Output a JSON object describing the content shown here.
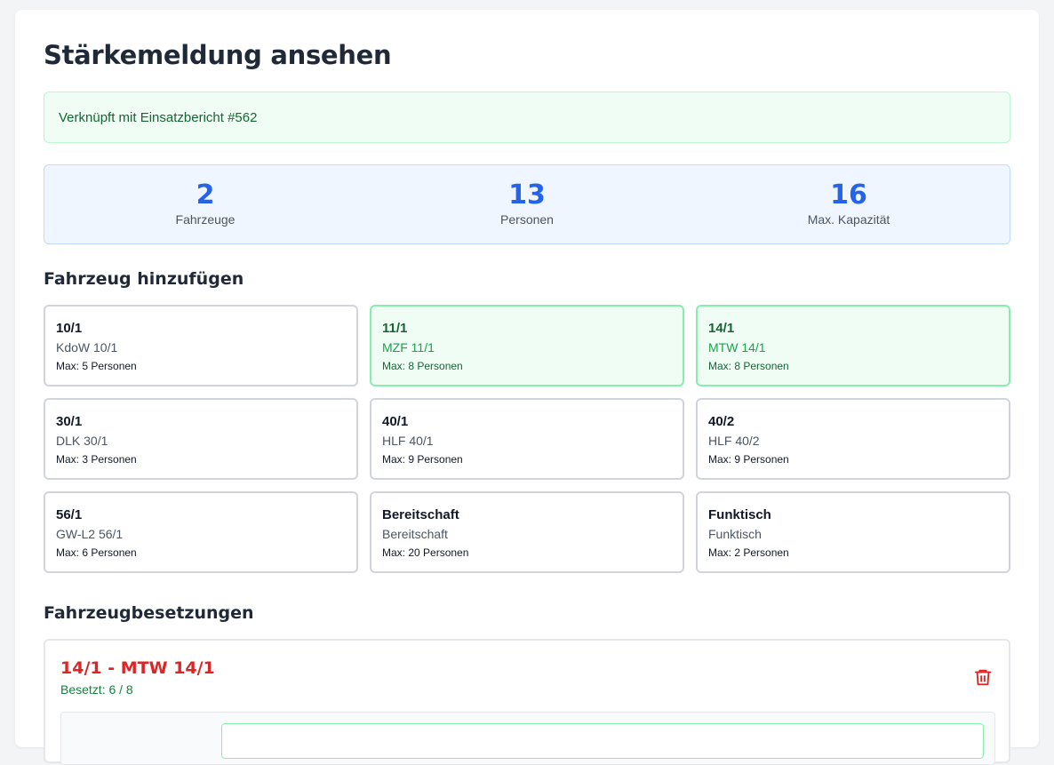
{
  "page": {
    "title": "Stärkemeldung ansehen"
  },
  "link_banner": {
    "text": "Verknüpft mit Einsatzbericht #562"
  },
  "stats": [
    {
      "value": "2",
      "label": "Fahrzeuge"
    },
    {
      "value": "13",
      "label": "Personen"
    },
    {
      "value": "16",
      "label": "Max. Kapazität"
    }
  ],
  "add_vehicle": {
    "title": "Fahrzeug hinzufügen",
    "vehicles": [
      {
        "code": "10/1",
        "name": "KdoW 10/1",
        "max": "Max: 5 Personen",
        "selected": false
      },
      {
        "code": "11/1",
        "name": "MZF 11/1",
        "max": "Max: 8 Personen",
        "selected": true
      },
      {
        "code": "14/1",
        "name": "MTW 14/1",
        "max": "Max: 8 Personen",
        "selected": true
      },
      {
        "code": "30/1",
        "name": "DLK 30/1",
        "max": "Max: 3 Personen",
        "selected": false
      },
      {
        "code": "40/1",
        "name": "HLF 40/1",
        "max": "Max: 9 Personen",
        "selected": false
      },
      {
        "code": "40/2",
        "name": "HLF 40/2",
        "max": "Max: 9 Personen",
        "selected": false
      },
      {
        "code": "56/1",
        "name": "GW-L2 56/1",
        "max": "Max: 6 Personen",
        "selected": false
      },
      {
        "code": "Bereitschaft",
        "name": "Bereitschaft",
        "max": "Max: 20 Personen",
        "selected": false
      },
      {
        "code": "Funktisch",
        "name": "Funktisch",
        "max": "Max: 2 Personen",
        "selected": false
      }
    ]
  },
  "assignments": {
    "title": "Fahrzeugbesetzungen",
    "items": [
      {
        "title": "14/1 - MTW 14/1",
        "occupancy": "Besetzt: 6 / 8",
        "delete_icon": "trash-icon"
      }
    ]
  },
  "colors": {
    "accent_blue": "#2563eb",
    "success_green": "#16a34a",
    "danger_red": "#dc2626"
  }
}
